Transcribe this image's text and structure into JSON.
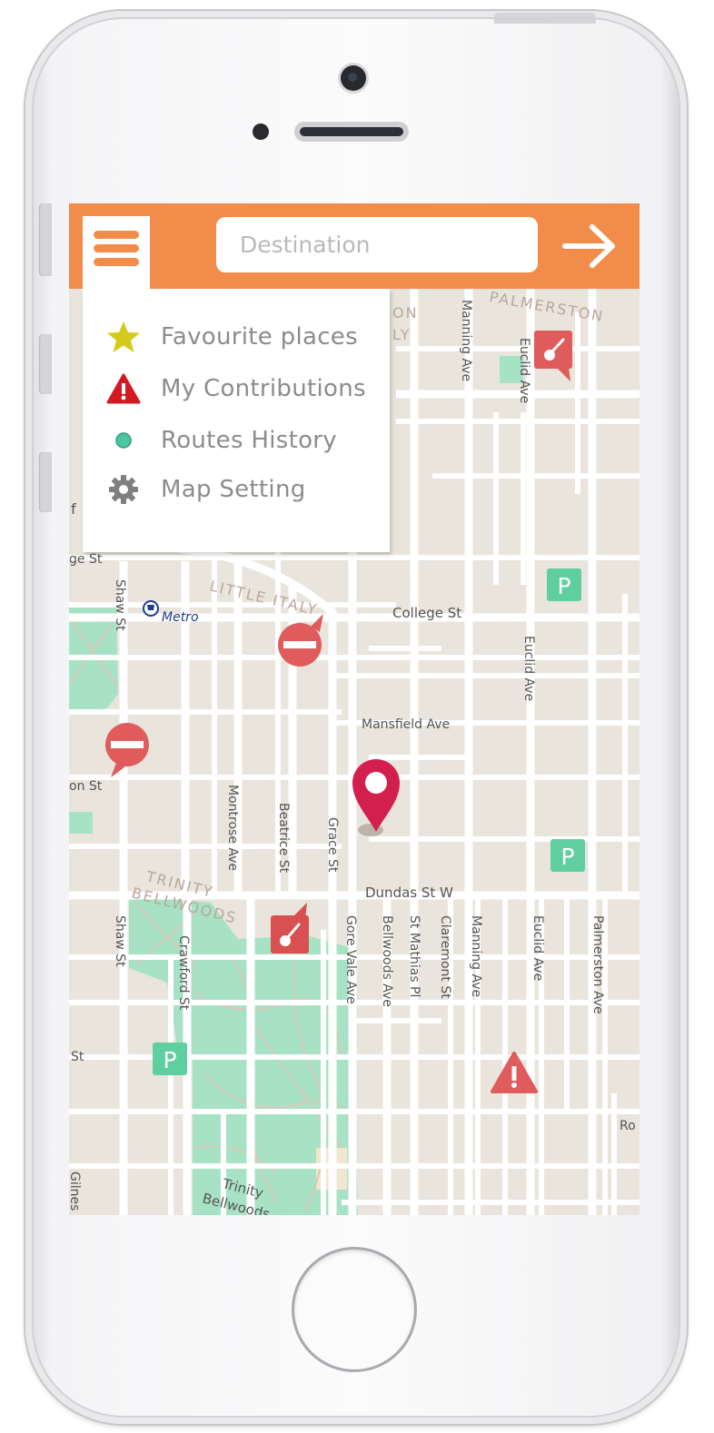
{
  "app": {
    "destination_placeholder": "Destination",
    "accent_color": "#f28c4a"
  },
  "menu": {
    "items": [
      {
        "label": "Favourite places",
        "icon": "star-icon",
        "color": "#d4c91d"
      },
      {
        "label": "My Contributions",
        "icon": "warning-icon",
        "color": "#d31a22"
      },
      {
        "label": "Routes History",
        "icon": "dot-icon",
        "color": "#4cc6a1"
      },
      {
        "label": "Map Setting",
        "icon": "gear-icon",
        "color": "#7f7f7f"
      }
    ]
  },
  "map": {
    "streets": {
      "palmerston": "PALMERSTON",
      "manning_ave_top": "Manning Ave",
      "euclid_ave_top": "Euclid Ave",
      "frag_on": "ON",
      "frag_ly": "LY",
      "frag_f": "f",
      "frag_ge_st": "ge St",
      "shaw_st_top": "Shaw St",
      "metro": "Metro",
      "little_italy": "LITTLE ITALY",
      "college_st": "College St",
      "euclid_ave_mid": "Euclid Ave",
      "mansfield_ave": "Mansfield Ave",
      "on_st": "on St",
      "montrose_ave": "Montrose Ave",
      "beatrice_st": "Beatrice St",
      "grace_st": "Grace St",
      "trinity": "TRINITY",
      "bellwoods": "BELLWOODS",
      "dundas_st_w": "Dundas St W",
      "shaw_st_bottom": "Shaw St",
      "crawford_st": "Crawford St",
      "gore_vale_ave": "Gore Vale Ave",
      "bellwoods_ave": "Bellwoods Ave",
      "st_mathias_pl": "St Mathias Pl",
      "claremont_st": "Claremont St",
      "manning_ave_bottom": "Manning Ave",
      "euclid_ave_bottom": "Euclid Ave",
      "palmerston_ave": "Palmerston Ave",
      "frag_st": "St",
      "frag_ro": "Ro",
      "frag_bottom_left": "Gilnes St",
      "trinity_park": "Trinity",
      "bellwoods_park": "Bellwoods"
    },
    "parking_label": "P",
    "colors": {
      "land": "#e9e4dc",
      "road": "#ffffff",
      "park": "#a8e2c4",
      "parking": "#5fcf9f",
      "marker": "#d21f4e",
      "hazard": "#e05c5c"
    }
  }
}
